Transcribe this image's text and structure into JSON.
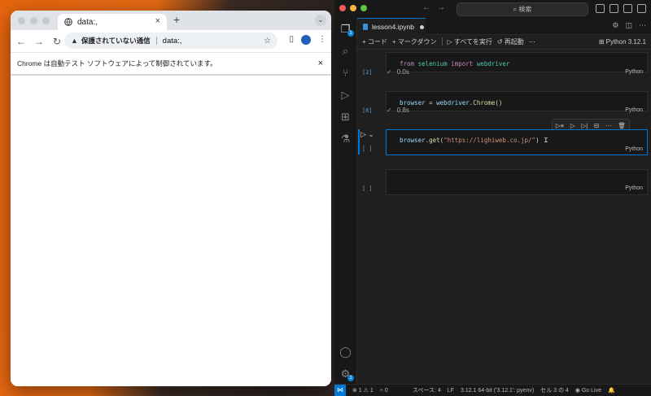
{
  "chrome": {
    "tab_title": "data:,",
    "tab_close": "×",
    "new_tab": "+",
    "tab_menu": "⌄",
    "security_label": "保護されていない通信",
    "url": "data:,",
    "infobar_message": "Chrome は自動テスト ソフトウェアによって制御されています。",
    "infobar_close": "×"
  },
  "vscode": {
    "search_placeholder": "検索",
    "tab_filename": "lesson4.ipynb",
    "toolbar": {
      "code": "コード",
      "markdown": "マークダウン",
      "run_all": "すべてを実行",
      "restart": "再起動",
      "kernel": "Python 3.12.1"
    },
    "cells": [
      {
        "exec": "[2]",
        "code": {
          "kw1": "from",
          "mod": "selenium",
          "kw2": "import",
          "name": "webdriver"
        },
        "status": "0.0s",
        "lang": "Python"
      },
      {
        "exec": "[6]",
        "code": {
          "var": "browser",
          "op": " = ",
          "obj": "webdriver",
          "call": ".Chrome()"
        },
        "status": "0.8s",
        "lang": "Python"
      },
      {
        "exec": "[ ]",
        "code": {
          "var": "browser",
          "fn": ".get",
          "open": "(",
          "str": "\"https://lighiweb.co.jp/\"",
          "close": ")"
        },
        "lang": "Python"
      },
      {
        "exec": "[ ]",
        "lang": "Python"
      }
    ],
    "statusbar": {
      "problems": "⊗ 1 ⚠ 1",
      "ports": "⑃ 0",
      "spaces": "スペース: 4",
      "eol": "LF",
      "interpreter": "3.12.1 64-bit ('3.12.1': pyenv)",
      "cell_pos": "セル 3 の 4",
      "golive": "Go Live"
    }
  }
}
